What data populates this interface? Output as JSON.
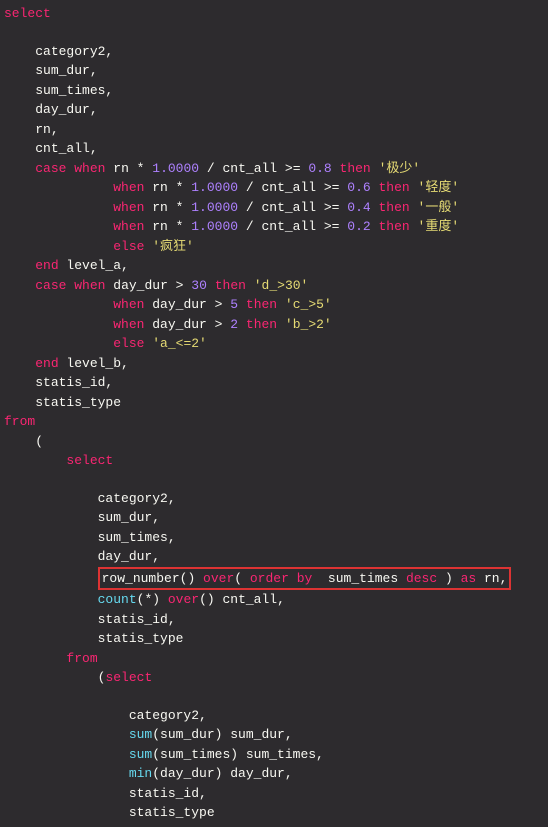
{
  "code": {
    "lines": [
      {
        "indent": 0,
        "segments": [
          {
            "t": "kw",
            "v": "select"
          }
        ]
      },
      {
        "indent": 0,
        "segments": []
      },
      {
        "indent": 2,
        "segments": [
          {
            "t": "ident",
            "v": "category2,"
          }
        ]
      },
      {
        "indent": 2,
        "segments": [
          {
            "t": "ident",
            "v": "sum_dur,"
          }
        ]
      },
      {
        "indent": 2,
        "segments": [
          {
            "t": "ident",
            "v": "sum_times,"
          }
        ]
      },
      {
        "indent": 2,
        "segments": [
          {
            "t": "ident",
            "v": "day_dur,"
          }
        ]
      },
      {
        "indent": 2,
        "segments": [
          {
            "t": "ident",
            "v": "rn,"
          }
        ]
      },
      {
        "indent": 2,
        "segments": [
          {
            "t": "ident",
            "v": "cnt_all,"
          }
        ]
      },
      {
        "indent": 2,
        "segments": [
          {
            "t": "kw",
            "v": "case"
          },
          {
            "t": "ident",
            "v": " "
          },
          {
            "t": "kw",
            "v": "when"
          },
          {
            "t": "ident",
            "v": " rn * "
          },
          {
            "t": "num",
            "v": "1.0000"
          },
          {
            "t": "ident",
            "v": " / cnt_all >= "
          },
          {
            "t": "num",
            "v": "0.8"
          },
          {
            "t": "ident",
            "v": " "
          },
          {
            "t": "kw",
            "v": "then"
          },
          {
            "t": "ident",
            "v": " "
          },
          {
            "t": "str",
            "v": "'极少'"
          }
        ]
      },
      {
        "indent": 7,
        "segments": [
          {
            "t": "kw",
            "v": "when"
          },
          {
            "t": "ident",
            "v": " rn * "
          },
          {
            "t": "num",
            "v": "1.0000"
          },
          {
            "t": "ident",
            "v": " / cnt_all >= "
          },
          {
            "t": "num",
            "v": "0.6"
          },
          {
            "t": "ident",
            "v": " "
          },
          {
            "t": "kw",
            "v": "then"
          },
          {
            "t": "ident",
            "v": " "
          },
          {
            "t": "str",
            "v": "'轻度'"
          }
        ]
      },
      {
        "indent": 7,
        "segments": [
          {
            "t": "kw",
            "v": "when"
          },
          {
            "t": "ident",
            "v": " rn * "
          },
          {
            "t": "num",
            "v": "1.0000"
          },
          {
            "t": "ident",
            "v": " / cnt_all >= "
          },
          {
            "t": "num",
            "v": "0.4"
          },
          {
            "t": "ident",
            "v": " "
          },
          {
            "t": "kw",
            "v": "then"
          },
          {
            "t": "ident",
            "v": " "
          },
          {
            "t": "str",
            "v": "'一般'"
          }
        ]
      },
      {
        "indent": 7,
        "segments": [
          {
            "t": "kw",
            "v": "when"
          },
          {
            "t": "ident",
            "v": " rn * "
          },
          {
            "t": "num",
            "v": "1.0000"
          },
          {
            "t": "ident",
            "v": " / cnt_all >= "
          },
          {
            "t": "num",
            "v": "0.2"
          },
          {
            "t": "ident",
            "v": " "
          },
          {
            "t": "kw",
            "v": "then"
          },
          {
            "t": "ident",
            "v": " "
          },
          {
            "t": "str",
            "v": "'重度'"
          }
        ]
      },
      {
        "indent": 7,
        "segments": [
          {
            "t": "kw",
            "v": "else"
          },
          {
            "t": "ident",
            "v": " "
          },
          {
            "t": "str",
            "v": "'疯狂'"
          }
        ]
      },
      {
        "indent": 2,
        "segments": [
          {
            "t": "kw",
            "v": "end"
          },
          {
            "t": "ident",
            "v": " level_a,"
          }
        ]
      },
      {
        "indent": 2,
        "segments": [
          {
            "t": "kw",
            "v": "case"
          },
          {
            "t": "ident",
            "v": " "
          },
          {
            "t": "kw",
            "v": "when"
          },
          {
            "t": "ident",
            "v": " day_dur > "
          },
          {
            "t": "num",
            "v": "30"
          },
          {
            "t": "ident",
            "v": " "
          },
          {
            "t": "kw",
            "v": "then"
          },
          {
            "t": "ident",
            "v": " "
          },
          {
            "t": "str",
            "v": "'d_>30'"
          }
        ]
      },
      {
        "indent": 7,
        "segments": [
          {
            "t": "kw",
            "v": "when"
          },
          {
            "t": "ident",
            "v": " day_dur > "
          },
          {
            "t": "num",
            "v": "5"
          },
          {
            "t": "ident",
            "v": " "
          },
          {
            "t": "kw",
            "v": "then"
          },
          {
            "t": "ident",
            "v": " "
          },
          {
            "t": "str",
            "v": "'c_>5'"
          }
        ]
      },
      {
        "indent": 7,
        "segments": [
          {
            "t": "kw",
            "v": "when"
          },
          {
            "t": "ident",
            "v": " day_dur > "
          },
          {
            "t": "num",
            "v": "2"
          },
          {
            "t": "ident",
            "v": " "
          },
          {
            "t": "kw",
            "v": "then"
          },
          {
            "t": "ident",
            "v": " "
          },
          {
            "t": "str",
            "v": "'b_>2'"
          }
        ]
      },
      {
        "indent": 7,
        "segments": [
          {
            "t": "kw",
            "v": "else"
          },
          {
            "t": "ident",
            "v": " "
          },
          {
            "t": "str",
            "v": "'a_<=2'"
          }
        ]
      },
      {
        "indent": 2,
        "segments": [
          {
            "t": "kw",
            "v": "end"
          },
          {
            "t": "ident",
            "v": " level_b,"
          }
        ]
      },
      {
        "indent": 2,
        "segments": [
          {
            "t": "ident",
            "v": "statis_id,"
          }
        ]
      },
      {
        "indent": 2,
        "segments": [
          {
            "t": "ident",
            "v": "statis_type"
          }
        ]
      },
      {
        "indent": 0,
        "segments": [
          {
            "t": "kw",
            "v": "from"
          }
        ]
      },
      {
        "indent": 2,
        "segments": [
          {
            "t": "ident",
            "v": "("
          }
        ]
      },
      {
        "indent": 4,
        "segments": [
          {
            "t": "kw",
            "v": "select"
          }
        ]
      },
      {
        "indent": 0,
        "segments": []
      },
      {
        "indent": 6,
        "segments": [
          {
            "t": "ident",
            "v": "category2,"
          }
        ]
      },
      {
        "indent": 6,
        "segments": [
          {
            "t": "ident",
            "v": "sum_dur,"
          }
        ]
      },
      {
        "indent": 6,
        "segments": [
          {
            "t": "ident",
            "v": "sum_times,"
          }
        ]
      },
      {
        "indent": 6,
        "segments": [
          {
            "t": "ident",
            "v": "day_dur,"
          }
        ]
      },
      {
        "indent": 6,
        "highlight": true,
        "segments": [
          {
            "t": "ident",
            "v": "row_number() "
          },
          {
            "t": "kw",
            "v": "over"
          },
          {
            "t": "ident",
            "v": "( "
          },
          {
            "t": "kw",
            "v": "order"
          },
          {
            "t": "ident",
            "v": " "
          },
          {
            "t": "kw",
            "v": "by"
          },
          {
            "t": "ident",
            "v": "  sum_times "
          },
          {
            "t": "kw",
            "v": "desc"
          },
          {
            "t": "ident",
            "v": " ) "
          },
          {
            "t": "kw",
            "v": "as"
          },
          {
            "t": "ident",
            "v": " rn,"
          }
        ]
      },
      {
        "indent": 6,
        "segments": [
          {
            "t": "func",
            "v": "count"
          },
          {
            "t": "ident",
            "v": "(*) "
          },
          {
            "t": "kw",
            "v": "over"
          },
          {
            "t": "ident",
            "v": "() cnt_all,"
          }
        ]
      },
      {
        "indent": 6,
        "segments": [
          {
            "t": "ident",
            "v": "statis_id,"
          }
        ]
      },
      {
        "indent": 6,
        "segments": [
          {
            "t": "ident",
            "v": "statis_type"
          }
        ]
      },
      {
        "indent": 4,
        "segments": [
          {
            "t": "kw",
            "v": "from"
          }
        ]
      },
      {
        "indent": 6,
        "segments": [
          {
            "t": "ident",
            "v": "("
          },
          {
            "t": "kw",
            "v": "select"
          }
        ]
      },
      {
        "indent": 0,
        "segments": []
      },
      {
        "indent": 8,
        "segments": [
          {
            "t": "ident",
            "v": "category2,"
          }
        ]
      },
      {
        "indent": 8,
        "segments": [
          {
            "t": "func",
            "v": "sum"
          },
          {
            "t": "ident",
            "v": "(sum_dur) sum_dur,"
          }
        ]
      },
      {
        "indent": 8,
        "segments": [
          {
            "t": "func",
            "v": "sum"
          },
          {
            "t": "ident",
            "v": "(sum_times) sum_times,"
          }
        ]
      },
      {
        "indent": 8,
        "segments": [
          {
            "t": "func",
            "v": "min"
          },
          {
            "t": "ident",
            "v": "(day_dur) day_dur,"
          }
        ]
      },
      {
        "indent": 8,
        "segments": [
          {
            "t": "ident",
            "v": "statis_id,"
          }
        ]
      },
      {
        "indent": 8,
        "segments": [
          {
            "t": "ident",
            "v": "statis_type"
          }
        ]
      }
    ]
  }
}
